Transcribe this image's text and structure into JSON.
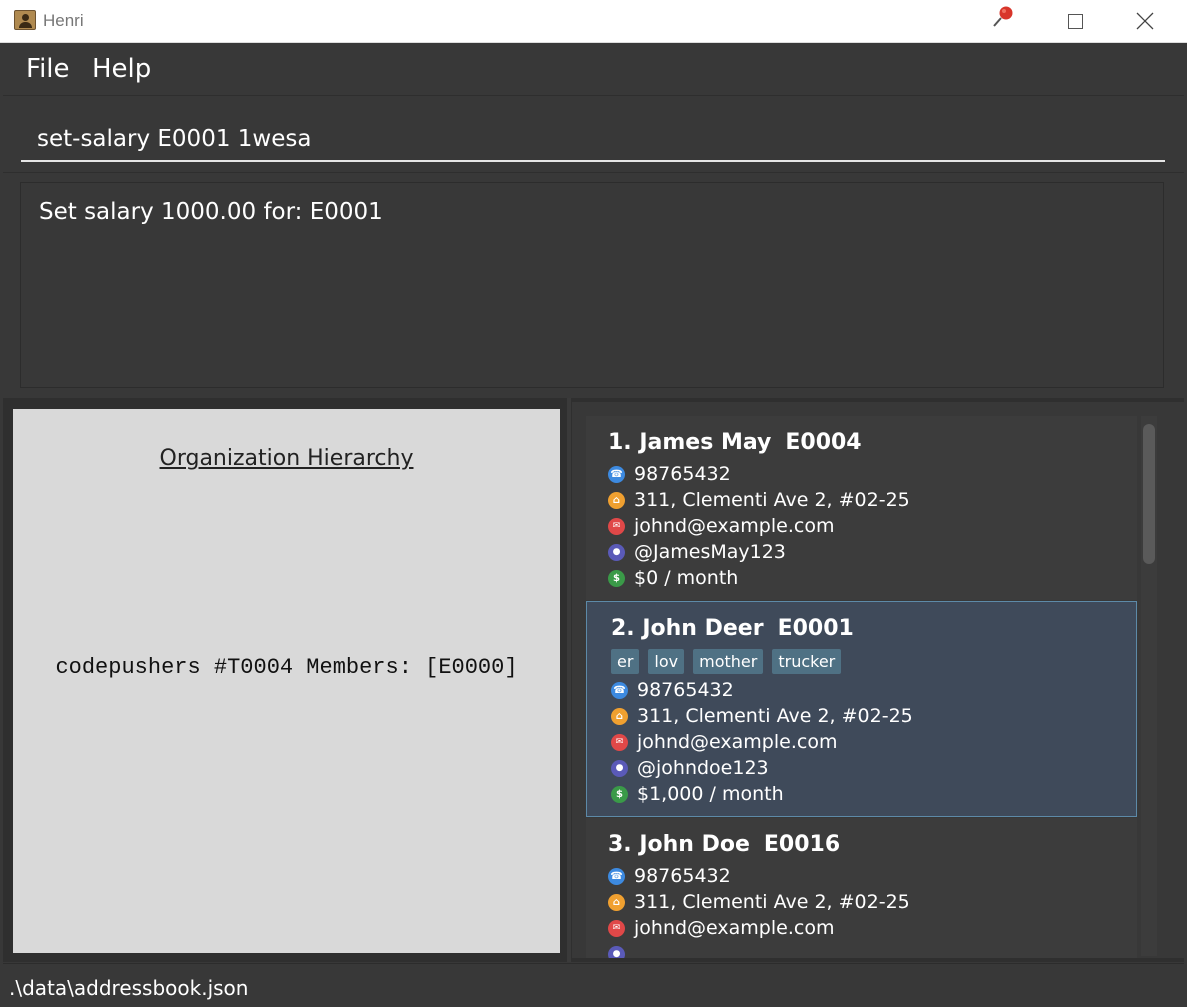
{
  "window": {
    "title": "Henri"
  },
  "menu": {
    "file": "File",
    "help": "Help"
  },
  "command": {
    "value": "set-salary E0001 1wesa"
  },
  "result": {
    "text": "Set salary 1000.00 for: E0001"
  },
  "hierarchy": {
    "title": "Organization Hierarchy",
    "team": "codepushers #T0004 Members: [E0000]"
  },
  "persons": [
    {
      "index_name": "1. James May",
      "id": "E0004",
      "tags": [],
      "phone": "98765432",
      "address": "311, Clementi Ave 2, #02-25",
      "email": "johnd@example.com",
      "github": "@JamesMay123",
      "salary": "$0 / month"
    },
    {
      "index_name": "2. John Deer",
      "id": "E0001",
      "tags": [
        "er",
        "lov",
        "mother",
        "trucker"
      ],
      "phone": "98765432",
      "address": "311, Clementi Ave 2, #02-25",
      "email": "johnd@example.com",
      "github": "@johndoe123",
      "salary": "$1,000 / month"
    },
    {
      "index_name": "3. John Doe",
      "id": "E0016",
      "tags": [],
      "phone": "98765432",
      "address": "311, Clementi Ave 2, #02-25",
      "email": "johnd@example.com"
    }
  ],
  "status": {
    "path": ".\\data\\addressbook.json"
  },
  "icons": {
    "phone": "phone-icon",
    "address": "home-icon",
    "email": "email-icon",
    "github": "github-icon",
    "salary": "dollar-icon"
  },
  "colors": {
    "background": "#383838",
    "selected_card": "#3f4a5a",
    "selected_border": "#5d8aa8",
    "tag": "#4f7184",
    "hierarchy_panel": "#d9d9d9"
  }
}
